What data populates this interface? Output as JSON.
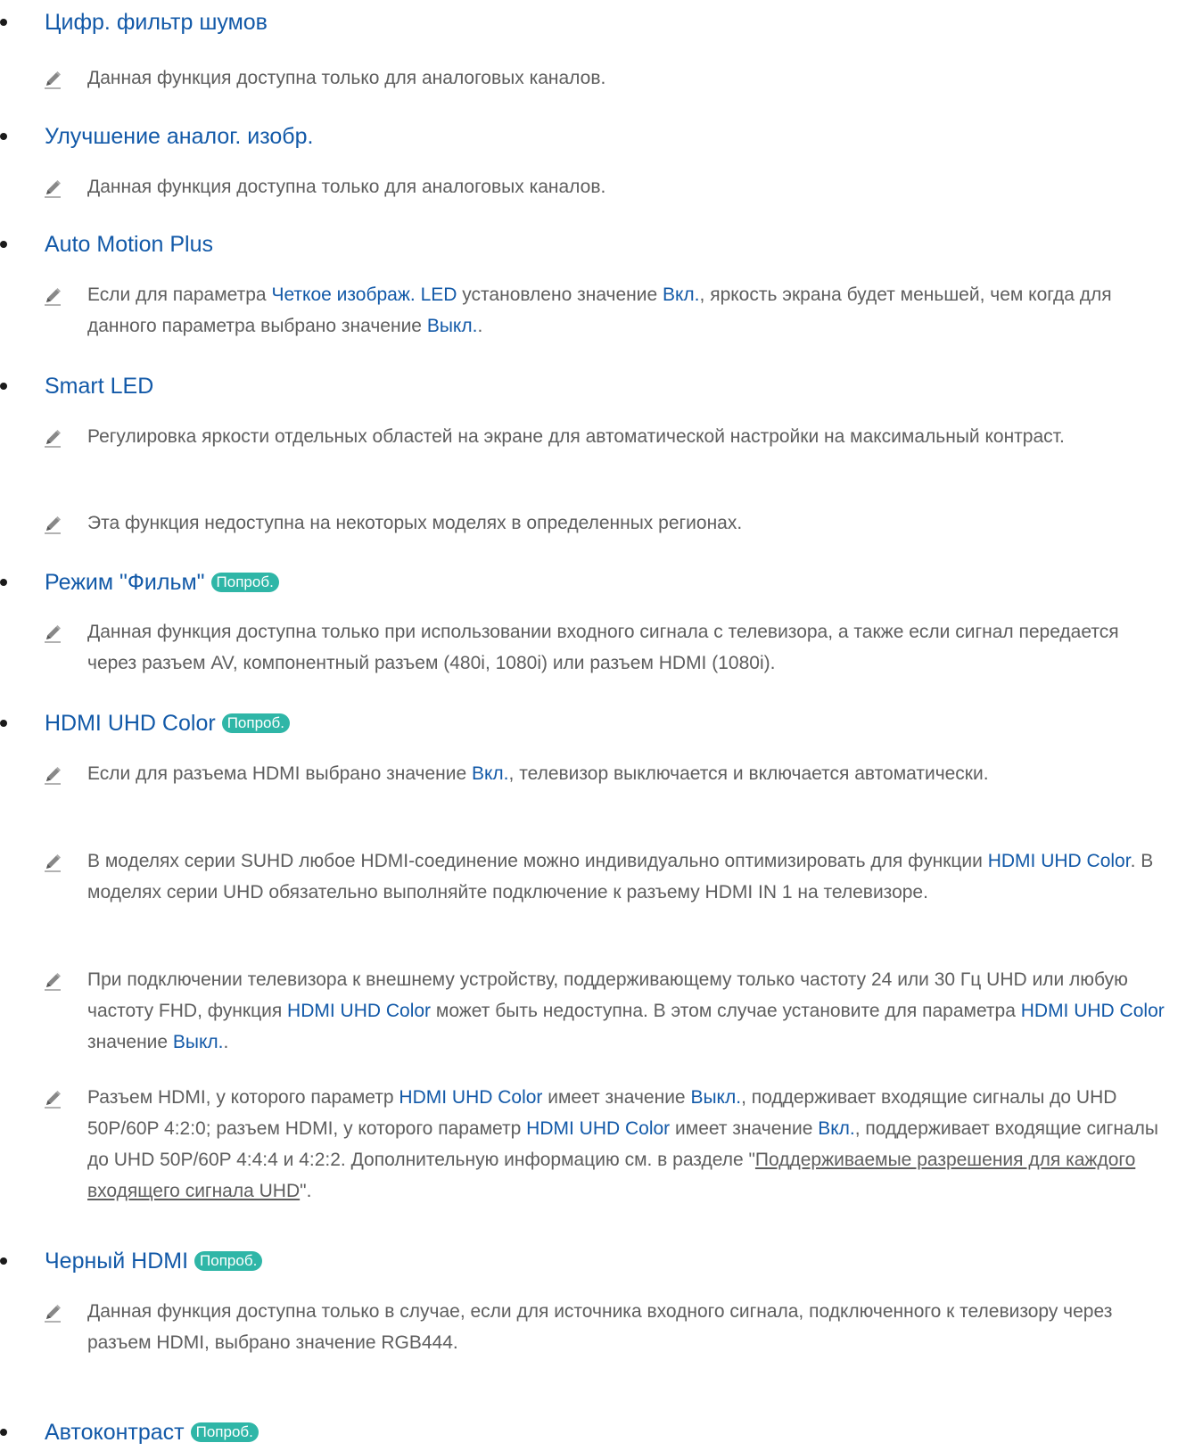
{
  "try_label": "Попроб.",
  "icons": {
    "note": "pencil-icon"
  },
  "colors": {
    "heading": "#1259a8",
    "body": "#5e5e5e",
    "badge": "#2fb6a7"
  },
  "items": [
    {
      "title": "Цифр. фильтр шумов",
      "notes": [
        {
          "parts": [
            "Данная функция доступна только для аналоговых каналов."
          ]
        }
      ]
    },
    {
      "title": "Улучшение аналог. изобр.",
      "notes": [
        {
          "parts": [
            "Данная функция доступна только для аналоговых каналов."
          ]
        }
      ]
    },
    {
      "title": "Auto Motion Plus",
      "notes": [
        {
          "parts": [
            "Если для параметра ",
            "Четкое изображ. LED",
            " установлено значение ",
            "Вкл.",
            ", яркость экрана будет меньшей, чем когда для данного параметра выбрано значение ",
            "Выкл.",
            "."
          ]
        }
      ]
    },
    {
      "title": "Smart LED",
      "notes": [
        {
          "parts": [
            "Регулировка яркости отдельных областей на экране для автоматической настройки на максимальный контраст."
          ]
        },
        {
          "parts": [
            "Эта функция недоступна на некоторых моделях в определенных регионах."
          ]
        }
      ]
    },
    {
      "title": "Режим \"Фильм\"",
      "notes": [
        {
          "parts": [
            "Данная функция доступна только при использовании входного сигнала с телевизора, а также если сигнал передается через разъем AV, компонентный разъем (480i, 1080i) или разъем HDMI (1080i)."
          ]
        }
      ]
    },
    {
      "title": "HDMI UHD Color",
      "notes": [
        {
          "parts": [
            "Если для разъема HDMI выбрано значение ",
            "Вкл.",
            ", телевизор выключается и включается автоматически."
          ]
        },
        {
          "parts": [
            "В моделях серии SUHD любое HDMI-соединение можно индивидуально оптимизировать для функции ",
            "HDMI UHD Color",
            ". В моделях серии UHD обязательно выполняйте подключение к разъему HDMI IN 1 на телевизоре."
          ]
        },
        {
          "parts": [
            "При подключении телевизора к внешнему устройству, поддерживающему только частоту 24 или 30 Гц UHD или любую частоту FHD, функция ",
            "HDMI UHD Color",
            " может быть недоступна. В этом случае установите для параметра ",
            "HDMI UHD Color",
            " значение ",
            "Выкл.",
            "."
          ]
        },
        {
          "parts": [
            "Разъем HDMI, у которого параметр ",
            "HDMI UHD Color",
            " имеет значение ",
            "Выкл.",
            ", поддерживает входящие сигналы до UHD 50P/60P 4:2:0; разъем HDMI, у которого параметр ",
            "HDMI UHD Color",
            " имеет значение ",
            "Вкл.",
            ", поддерживает входящие сигналы до UHD 50P/60P 4:4:4 и 4:2:2. Дополнительную информацию см. в разделе \"",
            "Поддерживаемые разрешения для каждого входящего сигнала UHD",
            "\"."
          ]
        }
      ]
    },
    {
      "title": "Черный HDMI",
      "notes": [
        {
          "parts": [
            "Данная функция доступна только в случае, если для источника входного сигнала, подключенного к телевизору через разъем HDMI, выбрано значение RGB444."
          ]
        }
      ]
    },
    {
      "title": "Автоконтраст",
      "notes": []
    }
  ]
}
